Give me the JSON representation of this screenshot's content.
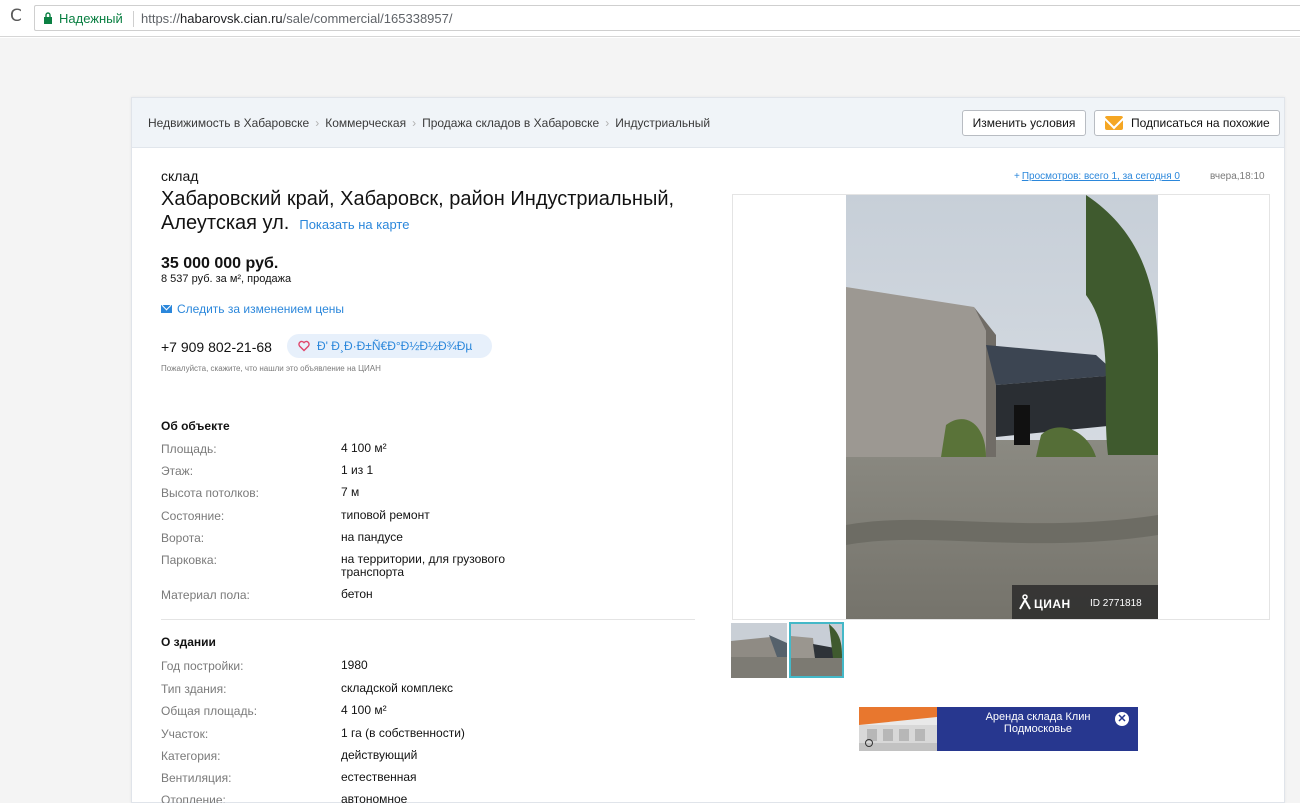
{
  "browser": {
    "reload_glyph": "C",
    "secure_label": "Надежный",
    "url_scheme": "https://",
    "url_host": "habarovsk.cian.ru",
    "url_path": "/sale/commercial/165338957/"
  },
  "breadcrumbs": [
    "Недвижимость в Хабаровске",
    "Коммерческая",
    "Продажа складов в Хабаровске",
    "Индустриальный"
  ],
  "breadcrumb_separator": "›",
  "toolbar": {
    "change_label": "Изменить условия",
    "subscribe_label": "Подписаться на похожие"
  },
  "offer": {
    "type": "склад",
    "address": "Хабаровский край, Хабаровск, район Индустриальный, Алеутская ул.",
    "map_link": "Показать на карте",
    "price": "35 000 000 руб.",
    "price_sub": "8 537 руб. за м², продажа",
    "watch_price": "Следить за изменением цены",
    "phone": "+7 909 802-21-68",
    "favorite_label": "Đ' Đ¸Đ·Đ±Ñ€Đ°Đ½Đ½Đ¾Đµ",
    "phone_note": "Пожалуйста, скажите, что нашли это объявление на ЦИАН"
  },
  "stats": {
    "views": "Просмотров: всего 1, за сегодня 0",
    "plus": "+",
    "time": "вчера,18:10"
  },
  "about_object": {
    "title": "Об объекте",
    "rows": [
      {
        "k": "Площадь:",
        "v": "4 100 м²"
      },
      {
        "k": "Этаж:",
        "v": "1 из 1"
      },
      {
        "k": "Высота потолков:",
        "v": "7 м"
      },
      {
        "k": "Состояние:",
        "v": "типовой ремонт"
      },
      {
        "k": "Ворота:",
        "v": "на пандусе"
      },
      {
        "k": "Парковка:",
        "v": "на территории, для грузового транспорта"
      },
      {
        "k": "Материал пола:",
        "v": "бетон"
      }
    ]
  },
  "about_building": {
    "title": "О здании",
    "rows": [
      {
        "k": "Год постройки:",
        "v": "1980"
      },
      {
        "k": "Тип здания:",
        "v": "складской комплекс"
      },
      {
        "k": "Общая площадь:",
        "v": "4 100 м²"
      },
      {
        "k": "Участок:",
        "v": "1 га (в собственности)"
      },
      {
        "k": "Категория:",
        "v": "действующий"
      },
      {
        "k": "Вентиляция:",
        "v": "естественная"
      },
      {
        "k": "Отопление:",
        "v": "автономное"
      }
    ]
  },
  "gallery": {
    "watermark_logo": "ЦИАН",
    "watermark_id": "ID 2771818"
  },
  "ad": {
    "text": "Аренда склада Клин Подмосковье",
    "close_glyph": "✕"
  },
  "icons": {
    "lock": "lock-icon",
    "envelope": "envelope-icon",
    "heart": "heart-icon",
    "mail": "mail-icon"
  },
  "colors": {
    "link": "#2b87db",
    "secure": "#0b8043",
    "accent_orange": "#f5a623",
    "ad_bg": "#27378f",
    "thumb_active": "#44b8c8"
  }
}
